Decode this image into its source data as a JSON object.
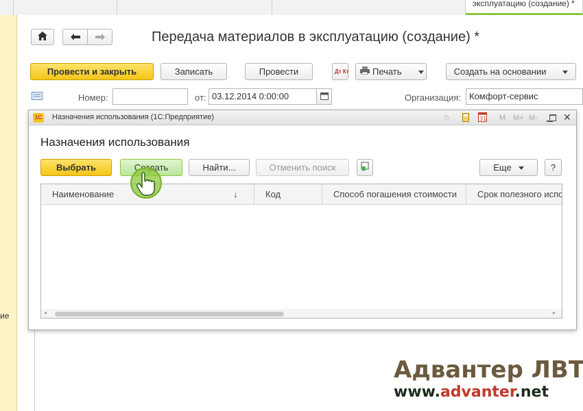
{
  "top_tabs": {
    "active_label": "эксплуатацию (создание) *"
  },
  "left_panel": {
    "text": "ие"
  },
  "document": {
    "title": "Передача материалов в эксплуатацию (создание) *",
    "toolbar": {
      "post_close": "Провести и закрыть",
      "save": "Записать",
      "post": "Провести",
      "print": "Печать",
      "create_based": "Создать на основании",
      "dt_kt": "Дт Кт"
    },
    "fields": {
      "number_label": "Номер:",
      "number_value": "",
      "date_label": "от:",
      "date_value": "03.12.2014  0:00:00",
      "org_label": "Организация:",
      "org_value": "Комфорт-сервис"
    }
  },
  "modal": {
    "window_title": "Назначения использования (1С:Предприятие)",
    "title": "Назначения использования",
    "titlebar_icons": [
      "star-icon",
      "calculator-icon",
      "calendar-icon",
      "M",
      "M+",
      "M-",
      "minimize-icon",
      "maximize-icon",
      "close-icon"
    ],
    "toolbar": {
      "select": "Выбрать",
      "create": "Создать",
      "find": "Найти...",
      "cancel_search": "Отменить поиск",
      "more": "Еще",
      "help": "?"
    },
    "columns": [
      "Наименование",
      "Код",
      "Способ погашения стоимости",
      "Срок полезного испо"
    ],
    "sort_indicator": "↓"
  },
  "watermark": {
    "line1": "Адвантер ЛВТИ",
    "line2_prefix": "www.",
    "line2_accent": "advanter",
    "line2_suffix": ".net"
  },
  "colors": {
    "accent_yellow": "#f5c518",
    "tab_green": "#8cc63f",
    "panel_yellow": "#fbf3c5"
  }
}
